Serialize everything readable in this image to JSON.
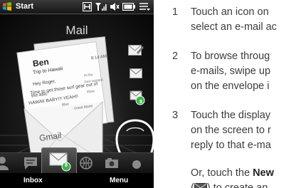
{
  "statusbar": {
    "start_label": "Start",
    "icons": [
      "data-icon",
      "signal-icon",
      "volume-icon",
      "battery-icon",
      "menu-icon"
    ]
  },
  "phone": {
    "title": "Mail",
    "envelope": {
      "sender": "Ben",
      "time": "8:14 AM",
      "subject": "Trip to Hawaii",
      "body_lines": [
        "Hey Roger,",
        "Time to get those surf gear out of",
        "the attic",
        "HAWAII BABY!!! YEAH!!"
      ],
      "back_lines": [
        "Hi Ro",
        "Just wanted",
        "Wow",
        "Blue",
        "Great Mane"
      ],
      "brand": "Gmail"
    },
    "badges": {
      "side": "8",
      "tab": "8"
    },
    "softkeys": {
      "left": "Inbox",
      "right": "Menu"
    }
  },
  "instructions": {
    "step1": {
      "num": "1",
      "line1": "Touch an icon on",
      "line2": "select an e-mail ac"
    },
    "step2": {
      "num": "2",
      "line1": "To browse throug",
      "line2": "e-mails, swipe up",
      "line3": "on the envelope i"
    },
    "step3": {
      "num": "3",
      "line1": "Touch the display",
      "line2": "on the screen to r",
      "line3": "reply to that e-ma"
    },
    "or_line": {
      "prefix": "Or, touch the ",
      "bold": "New",
      "suffix_pre": "(",
      "suffix_post": ") to create an"
    }
  },
  "colors": {
    "accent_green": "#3bb34a",
    "text": "#3c3c3c"
  }
}
